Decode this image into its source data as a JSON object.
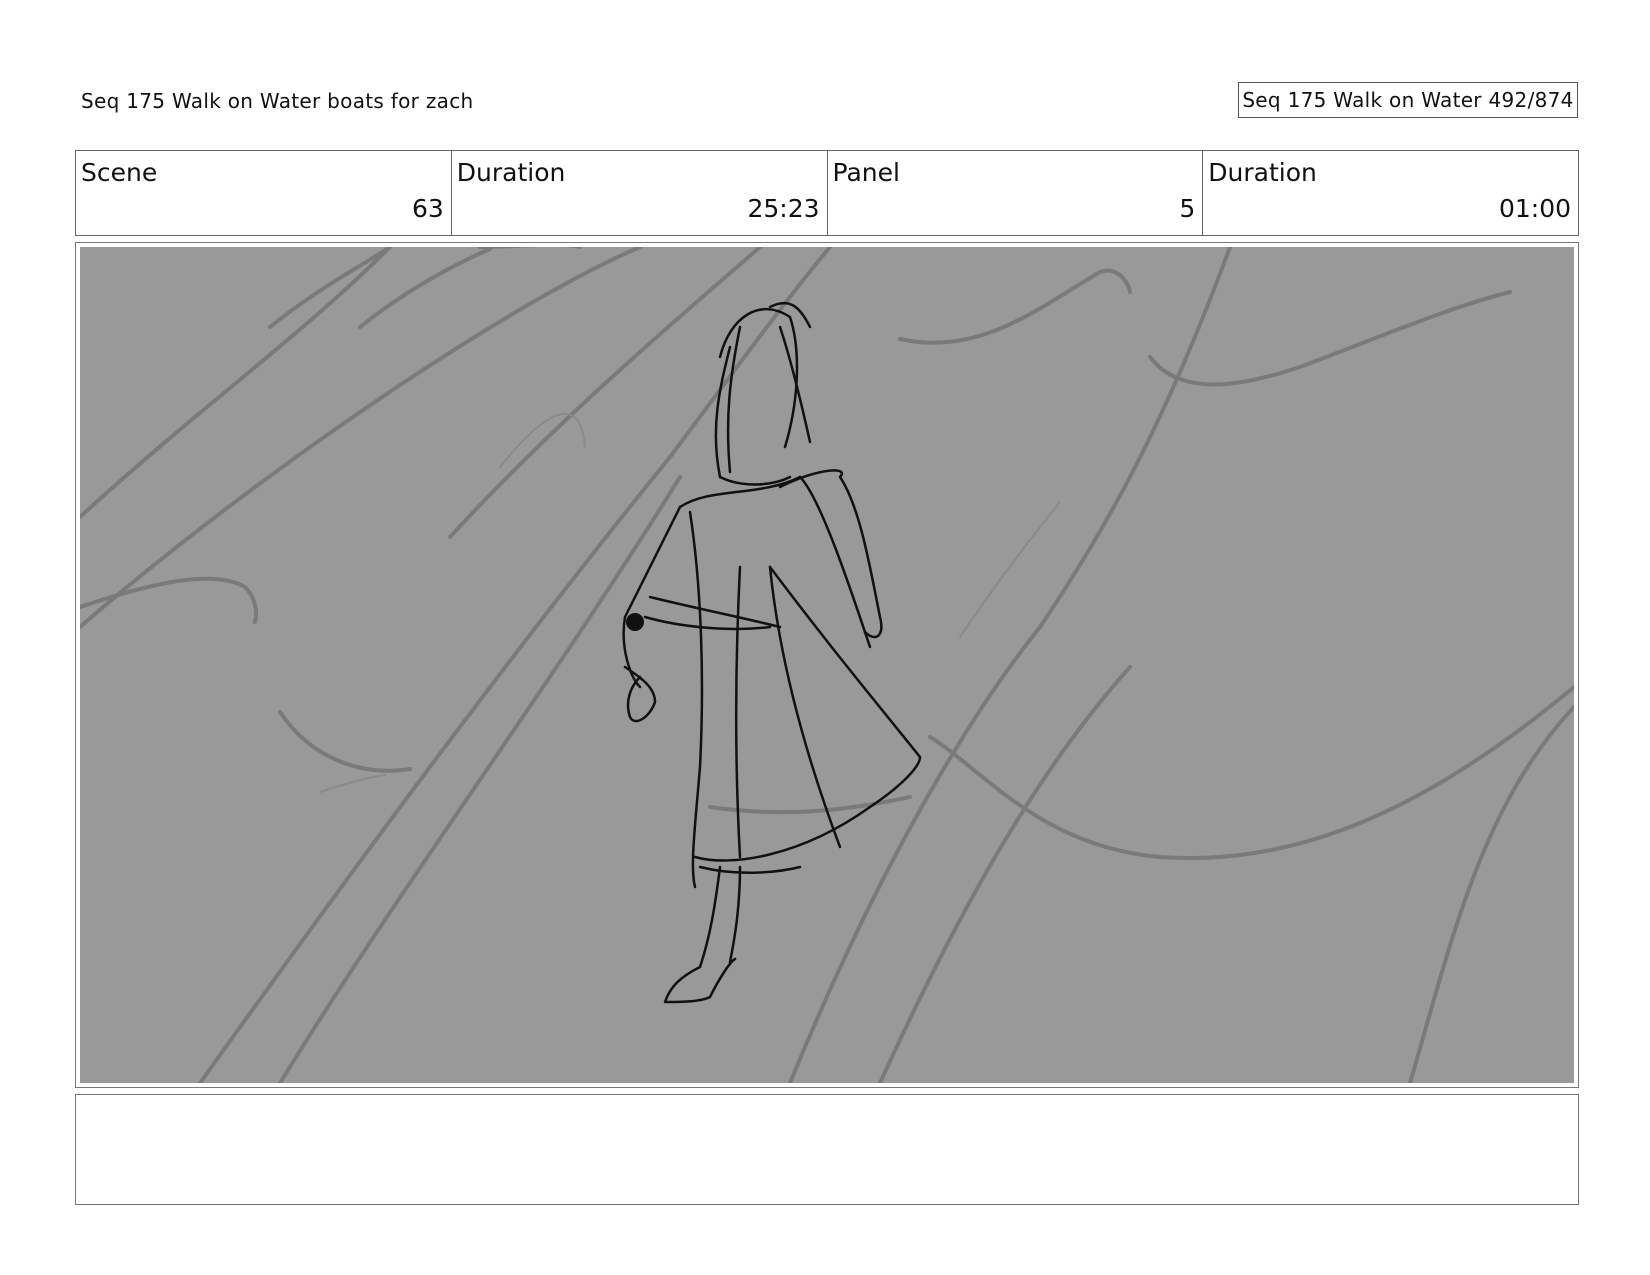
{
  "header": {
    "title": "Seq 175 Walk on Water  boats for zach",
    "page_counter": "Seq 175 Walk on Water 492/874"
  },
  "info": {
    "scene_label": "Scene",
    "scene_value": "63",
    "scene_duration_label": "Duration",
    "scene_duration_value": "25:23",
    "panel_label": "Panel",
    "panel_value": "5",
    "panel_duration_label": "Duration",
    "panel_duration_value": "01:00"
  },
  "panel": {
    "background_color": "#999999",
    "sketch": "storyboard-sketch-figure-walking-on-water"
  },
  "notes": {
    "text": ""
  }
}
